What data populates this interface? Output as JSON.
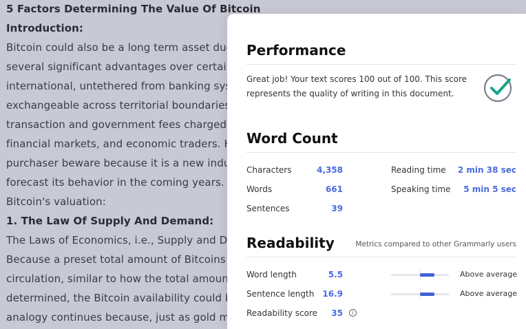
{
  "document": {
    "lines": [
      {
        "text": " 5 Factors Determining The Value Of Bitcoin",
        "bold": true
      },
      {
        "text": "Introduction:",
        "bold": true
      },
      {
        "text": "Bitcoin could also be a long term asset due to",
        "bold": false
      },
      {
        "text": "several significant advantages over certain go",
        "bold": false
      },
      {
        "text": "international, untethered from banking system",
        "bold": false
      },
      {
        "text": "exchangeable across territorial boundaries, an",
        "bold": false
      },
      {
        "text": "transaction and government fees charged by",
        "bold": false
      },
      {
        "text": "financial markets, and economic traders. How",
        "bold": false
      },
      {
        "text": "purchaser beware because it is a new industry",
        "bold": false
      },
      {
        "text": "forecast its behavior in the coming years. Five",
        "bold": false
      },
      {
        "text": "Bitcoin's valuation:",
        "bold": false
      },
      {
        "text": "1. The Law Of Supply And Demand:",
        "bold": true
      },
      {
        "text": "The Laws of Economics, i.e., Supply and Dema",
        "bold": false
      },
      {
        "text": "Because a preset total amount of Bitcoins cou",
        "bold": false
      },
      {
        "text": "circulation, similar to how the total amount of",
        "bold": false
      },
      {
        "text": "determined, the Bitcoin availability could be re",
        "bold": false
      },
      {
        "text": "analogy continues because, just as gold mine",
        "bold": false
      }
    ]
  },
  "panel": {
    "performance": {
      "title": "Performance",
      "text": "Great job! Your text scores 100 out of 100. This score represents the quality of writing in this document.",
      "check_color": "#15a589"
    },
    "word_count": {
      "title": "Word Count",
      "characters_label": "Characters",
      "characters_value": "4,358",
      "words_label": "Words",
      "words_value": "661",
      "sentences_label": "Sentences",
      "sentences_value": "39",
      "reading_label": "Reading time",
      "reading_value": "2 min 38 sec",
      "speaking_label": "Speaking time",
      "speaking_value": "5 min 5 sec"
    },
    "readability": {
      "title": "Readability",
      "note": "Metrics compared to other Grammarly users",
      "word_length_label": "Word length",
      "word_length_value": "5.5",
      "word_length_rating": "Above average",
      "word_length_level": 0.75,
      "sentence_length_label": "Sentence length",
      "sentence_length_value": "16.9",
      "sentence_length_rating": "Above average",
      "sentence_length_level": 0.75,
      "score_label": "Readability score",
      "score_value": "35",
      "info_icon": "i"
    },
    "accent_color": "#4a6ae0"
  }
}
